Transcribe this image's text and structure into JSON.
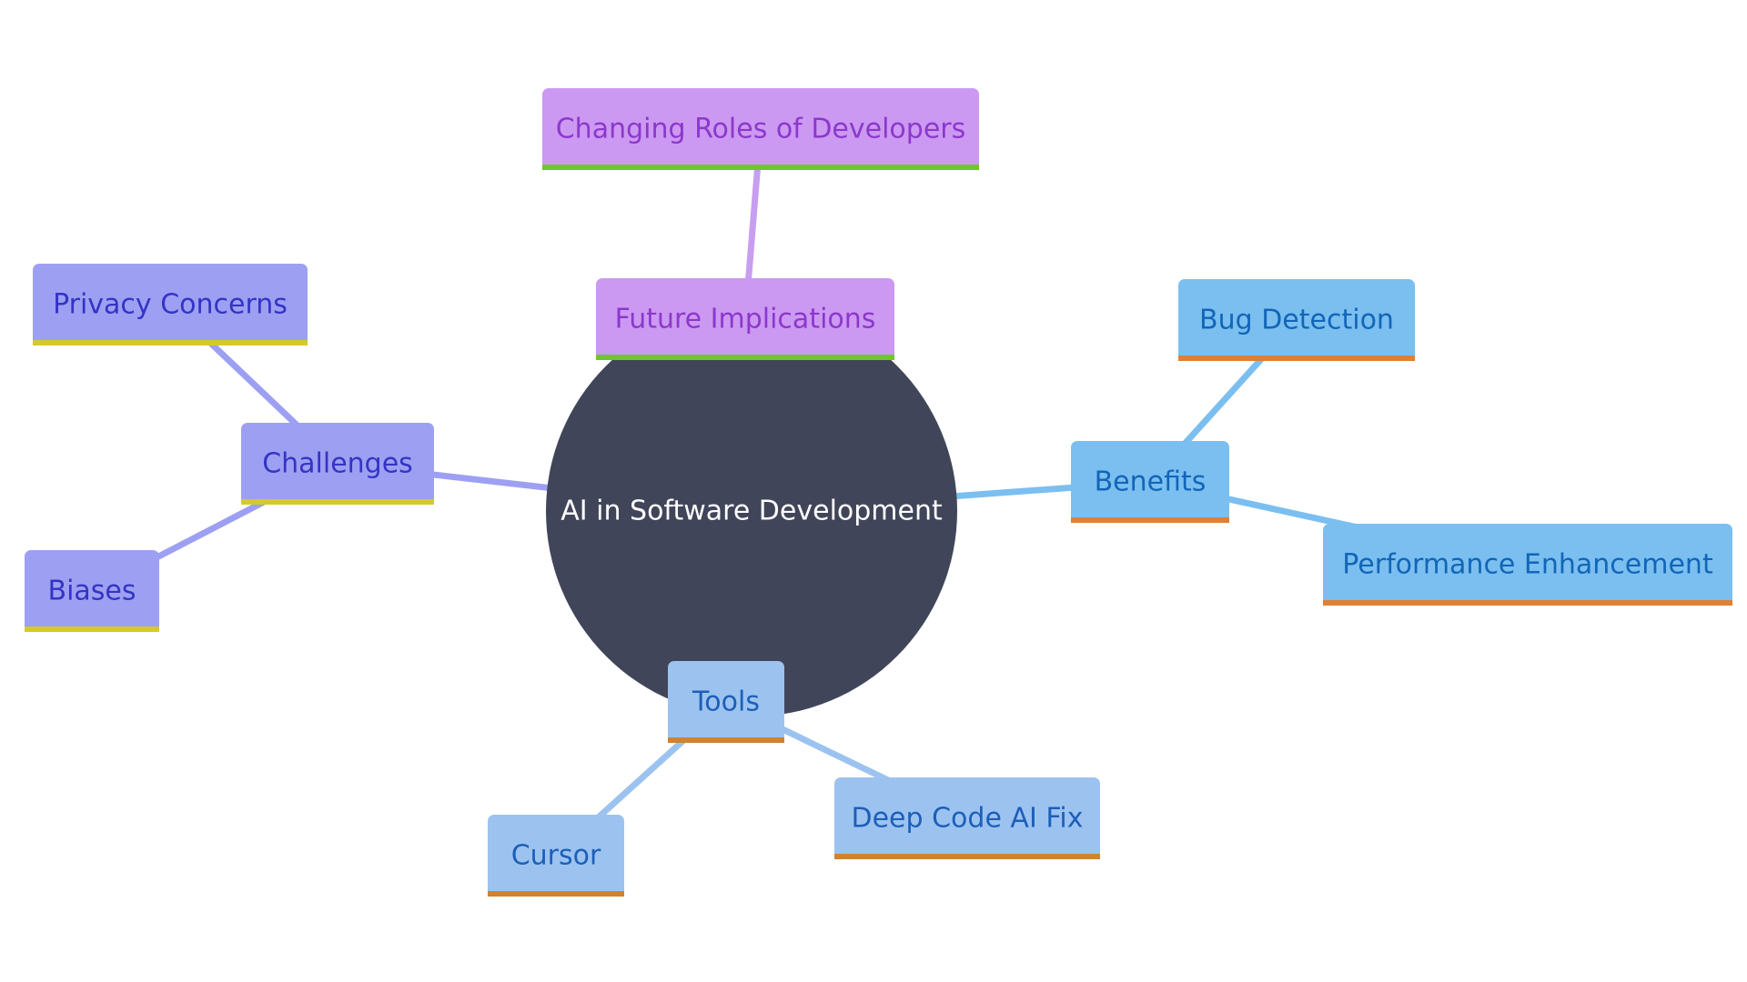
{
  "diagram": {
    "center": {
      "label": "AI in Software Development",
      "fill": "#414559",
      "text_color": "#ffffff"
    },
    "branches": [
      {
        "key": "future",
        "label": "Future Implications",
        "fill": "#cc99f2",
        "text_color": "#8c38cc",
        "underline": "#72c52a",
        "edge": "#c89ef0",
        "children": [
          {
            "key": "roles",
            "label": "Changing Roles of Developers"
          }
        ]
      },
      {
        "key": "benefits",
        "label": "Benefits",
        "fill": "#7bbff0",
        "text_color": "#1266b8",
        "underline": "#de8035",
        "edge": "#7bbff0",
        "children": [
          {
            "key": "bug",
            "label": "Bug Detection"
          },
          {
            "key": "perf",
            "label": "Performance Enhancement"
          }
        ]
      },
      {
        "key": "tools",
        "label": "Tools",
        "fill": "#9cc3f0",
        "text_color": "#1d5fb8",
        "underline": "#d0822e",
        "edge": "#9cc3f0",
        "children": [
          {
            "key": "cursor",
            "label": "Cursor"
          },
          {
            "key": "deepcode",
            "label": "Deep Code AI Fix"
          }
        ]
      },
      {
        "key": "challenges",
        "label": "Challenges",
        "fill": "#9da0f2",
        "text_color": "#3434c4",
        "underline": "#d6c92e",
        "edge": "#9da0f2",
        "children": [
          {
            "key": "privacy",
            "label": "Privacy Concerns"
          },
          {
            "key": "biases",
            "label": "Biases"
          }
        ]
      }
    ]
  }
}
